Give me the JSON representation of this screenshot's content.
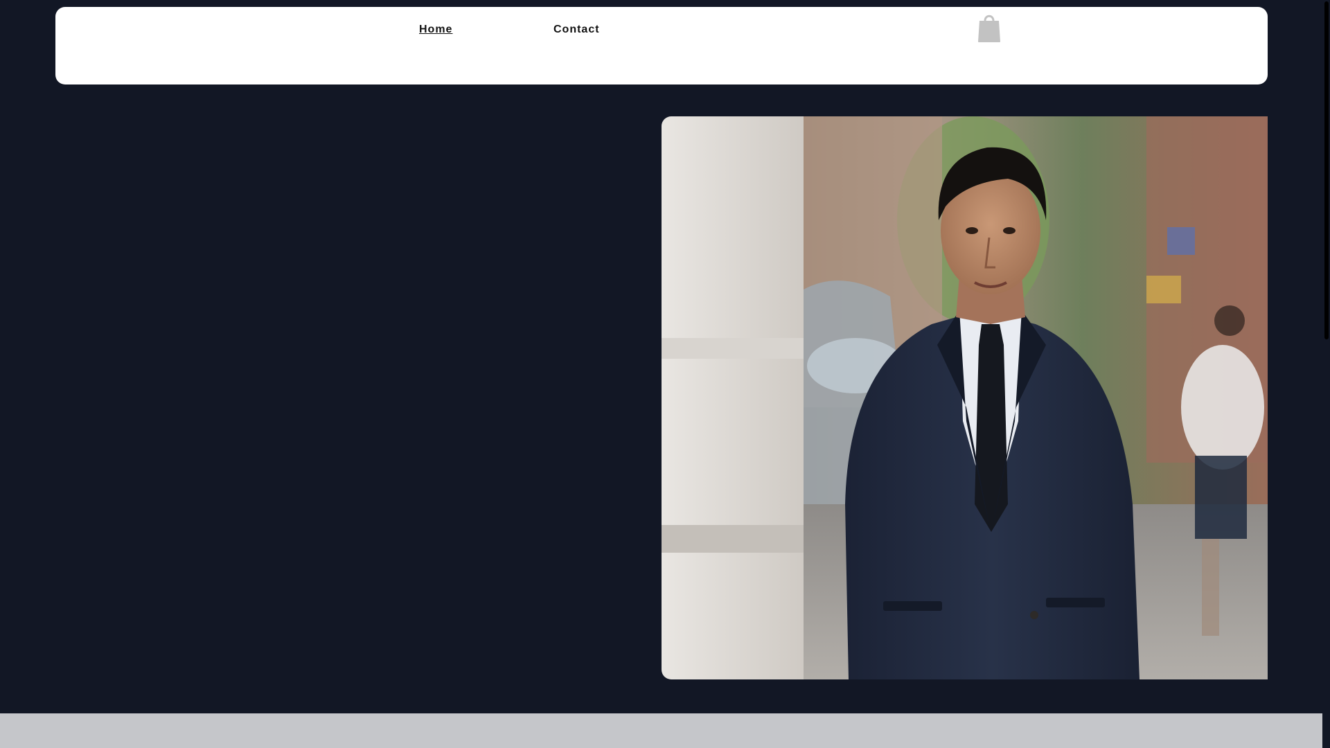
{
  "header": {
    "nav": [
      {
        "label": "Home",
        "active": true
      },
      {
        "label": "Contact",
        "active": false
      }
    ],
    "cart_icon": "shopping-bag-icon"
  },
  "hero": {
    "image_icon": "portrait-photo"
  },
  "colors": {
    "background": "#121725",
    "header_bg": "#ffffff",
    "bottom_strip": "#c5c6ca",
    "cart_icon": "#c2c2c2"
  }
}
